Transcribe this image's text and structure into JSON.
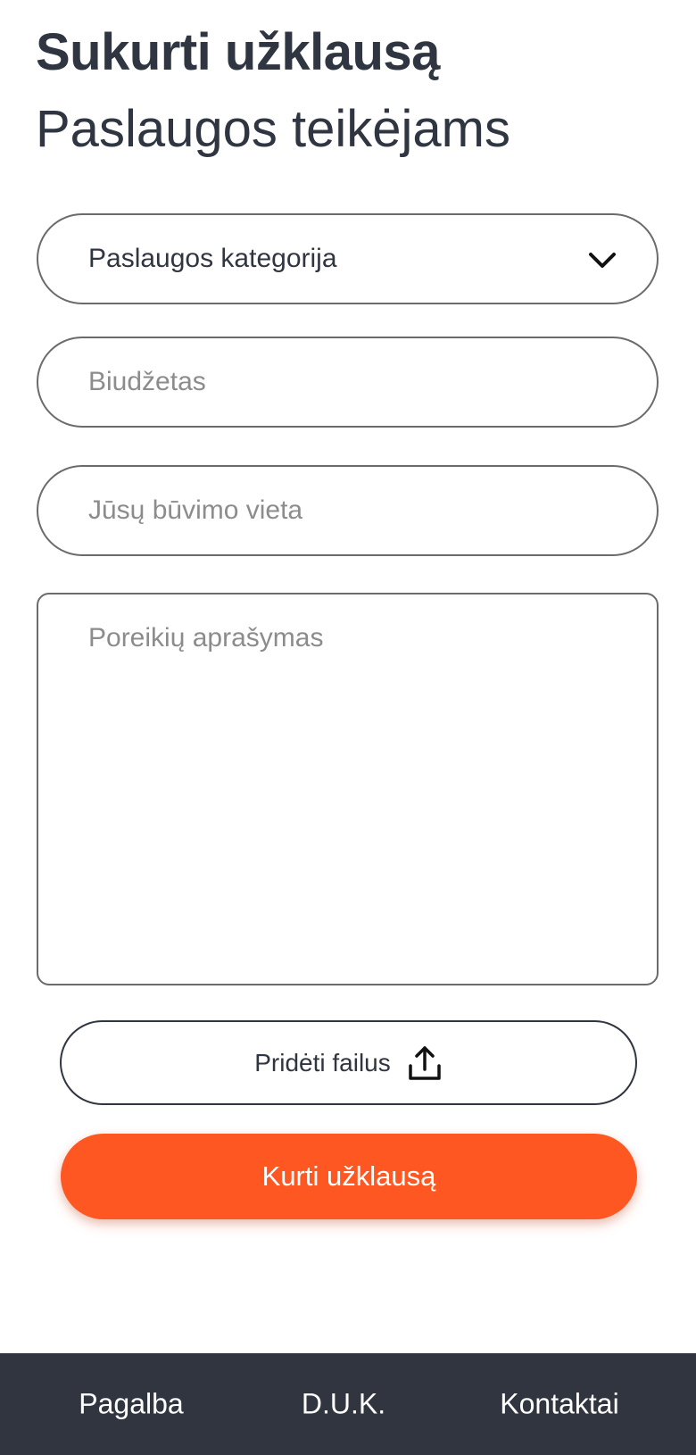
{
  "header": {
    "title": "Sukurti užklausą",
    "subtitle": "Paslaugos teikėjams"
  },
  "form": {
    "category": {
      "value": "Paslaugos kategorija",
      "icon": "chevron-down-icon"
    },
    "budget": {
      "placeholder": "Biudžetas"
    },
    "location": {
      "placeholder": "Jūsų būvimo vieta"
    },
    "description": {
      "placeholder": "Poreikių aprašymas"
    },
    "upload": {
      "label": "Pridėti failus",
      "icon": "upload-icon"
    },
    "submit": {
      "label": "Kurti užklausą"
    }
  },
  "footer": {
    "links": [
      {
        "label": "Pagalba"
      },
      {
        "label": "D.U.K."
      },
      {
        "label": "Kontaktai"
      }
    ]
  },
  "colors": {
    "accent": "#ff5722",
    "text": "#2f3541",
    "footer_bg": "#31353f",
    "placeholder": "#8c8c8c",
    "border": "#6b6b6b"
  }
}
